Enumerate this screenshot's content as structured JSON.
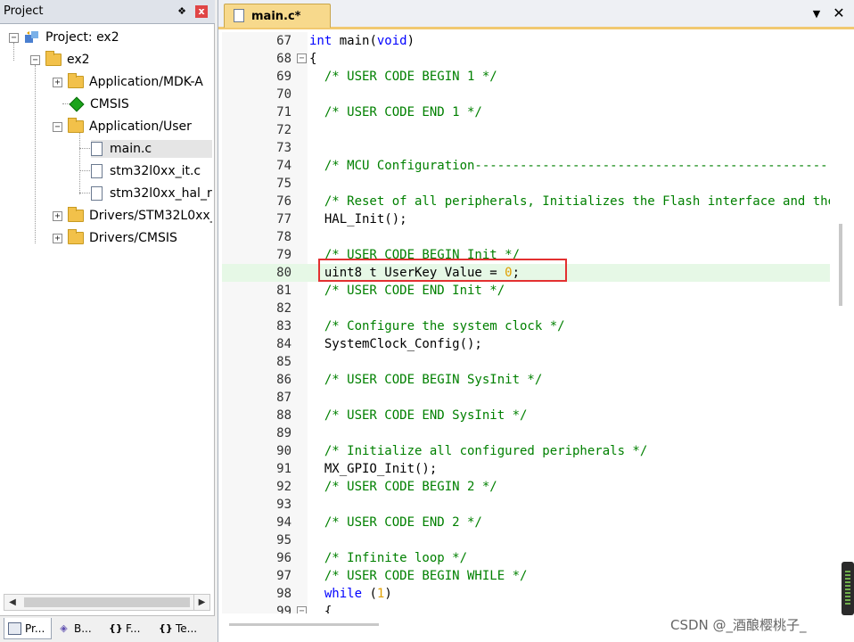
{
  "project_panel": {
    "title": "Project",
    "pin": "❖",
    "close": "x",
    "tree": [
      {
        "label": "Project: ex2",
        "icon": "project-icon"
      },
      {
        "label": "ex2",
        "icon": "target-icon"
      },
      {
        "label": "Application/MDK-A",
        "icon": "folder-icon"
      },
      {
        "label": "CMSIS",
        "icon": "cmsis-icon"
      },
      {
        "label": "Application/User",
        "icon": "folder-open-icon"
      },
      {
        "label": "main.c",
        "icon": "file-icon"
      },
      {
        "label": "stm32l0xx_it.c",
        "icon": "file-icon"
      },
      {
        "label": "stm32l0xx_hal_r",
        "icon": "file-icon"
      },
      {
        "label": "Drivers/STM32L0xx_",
        "icon": "folder-icon"
      },
      {
        "label": "Drivers/CMSIS",
        "icon": "folder-icon"
      }
    ],
    "bottom_tabs": [
      {
        "label": "Pr...",
        "icon": "project-tab-icon"
      },
      {
        "label": "B...",
        "icon": "books-icon"
      },
      {
        "label": "F...",
        "icon": "functions-icon"
      },
      {
        "label": "Te...",
        "icon": "templates-icon"
      }
    ]
  },
  "editor": {
    "tab_label": "main.c*",
    "menu_glyph": "▼",
    "close_glyph": "✕",
    "lines": [
      {
        "n": "67",
        "fold": "",
        "parts": [
          {
            "t": "int",
            "c": "kw"
          },
          {
            "t": " main(",
            "c": ""
          },
          {
            "t": "void",
            "c": "kw"
          },
          {
            "t": ")",
            "c": ""
          }
        ]
      },
      {
        "n": "68",
        "fold": "−",
        "parts": [
          {
            "t": "{",
            "c": ""
          }
        ]
      },
      {
        "n": "69",
        "fold": "",
        "parts": [
          {
            "t": "  /* USER CODE BEGIN 1 */",
            "c": "cm"
          }
        ]
      },
      {
        "n": "70",
        "fold": "",
        "parts": []
      },
      {
        "n": "71",
        "fold": "",
        "parts": [
          {
            "t": "  /* USER CODE END 1 */",
            "c": "cm"
          }
        ]
      },
      {
        "n": "72",
        "fold": "",
        "parts": []
      },
      {
        "n": "73",
        "fold": "",
        "parts": []
      },
      {
        "n": "74",
        "fold": "",
        "parts": [
          {
            "t": "  /* MCU Configuration--------------------------------------------------------",
            "c": "cm"
          }
        ]
      },
      {
        "n": "75",
        "fold": "",
        "parts": []
      },
      {
        "n": "76",
        "fold": "",
        "parts": [
          {
            "t": "  /* Reset of all peripherals, Initializes the Flash interface and the Systick. */",
            "c": "cm"
          }
        ]
      },
      {
        "n": "77",
        "fold": "",
        "parts": [
          {
            "t": "  HAL_Init();",
            "c": ""
          }
        ]
      },
      {
        "n": "78",
        "fold": "",
        "parts": []
      },
      {
        "n": "79",
        "fold": "",
        "parts": [
          {
            "t": "  /* USER CODE BEGIN Init */",
            "c": "cm"
          }
        ]
      },
      {
        "n": "80",
        "fold": "",
        "hl": true,
        "parts": [
          {
            "t": "  uint8 t UserKey Value = ",
            "c": ""
          },
          {
            "t": "0",
            "c": "num"
          },
          {
            "t": ";",
            "c": ""
          }
        ]
      },
      {
        "n": "81",
        "fold": "",
        "parts": [
          {
            "t": "  /* USER CODE END Init */",
            "c": "cm"
          }
        ]
      },
      {
        "n": "82",
        "fold": "",
        "parts": []
      },
      {
        "n": "83",
        "fold": "",
        "parts": [
          {
            "t": "  /* Configure the system clock */",
            "c": "cm"
          }
        ]
      },
      {
        "n": "84",
        "fold": "",
        "parts": [
          {
            "t": "  SystemClock_Config();",
            "c": ""
          }
        ]
      },
      {
        "n": "85",
        "fold": "",
        "parts": []
      },
      {
        "n": "86",
        "fold": "",
        "parts": [
          {
            "t": "  /* USER CODE BEGIN SysInit */",
            "c": "cm"
          }
        ]
      },
      {
        "n": "87",
        "fold": "",
        "parts": []
      },
      {
        "n": "88",
        "fold": "",
        "parts": [
          {
            "t": "  /* USER CODE END SysInit */",
            "c": "cm"
          }
        ]
      },
      {
        "n": "89",
        "fold": "",
        "parts": []
      },
      {
        "n": "90",
        "fold": "",
        "parts": [
          {
            "t": "  /* Initialize all configured peripherals */",
            "c": "cm"
          }
        ]
      },
      {
        "n": "91",
        "fold": "",
        "parts": [
          {
            "t": "  MX_GPIO_Init();",
            "c": ""
          }
        ]
      },
      {
        "n": "92",
        "fold": "",
        "parts": [
          {
            "t": "  /* USER CODE BEGIN 2 */",
            "c": "cm"
          }
        ]
      },
      {
        "n": "93",
        "fold": "",
        "parts": []
      },
      {
        "n": "94",
        "fold": "",
        "parts": [
          {
            "t": "  /* USER CODE END 2 */",
            "c": "cm"
          }
        ]
      },
      {
        "n": "95",
        "fold": "",
        "parts": []
      },
      {
        "n": "96",
        "fold": "",
        "parts": [
          {
            "t": "  /* Infinite loop */",
            "c": "cm"
          }
        ]
      },
      {
        "n": "97",
        "fold": "",
        "parts": [
          {
            "t": "  /* USER CODE BEGIN WHILE */",
            "c": "cm"
          }
        ]
      },
      {
        "n": "98",
        "fold": "",
        "parts": [
          {
            "t": "  while",
            "c": "kw"
          },
          {
            "t": " (",
            "c": ""
          },
          {
            "t": "1",
            "c": "num"
          },
          {
            "t": ")",
            "c": ""
          }
        ]
      },
      {
        "n": "99",
        "fold": "−",
        "parts": [
          {
            "t": "  {",
            "c": ""
          }
        ]
      }
    ]
  },
  "watermark": "CSDN @_酒酿樱桃子_",
  "colors": {
    "keyword": "#0000ff",
    "comment": "#008000",
    "number": "#e0a000",
    "highlight": "#e6f8e6",
    "annotation": "#e33030"
  }
}
